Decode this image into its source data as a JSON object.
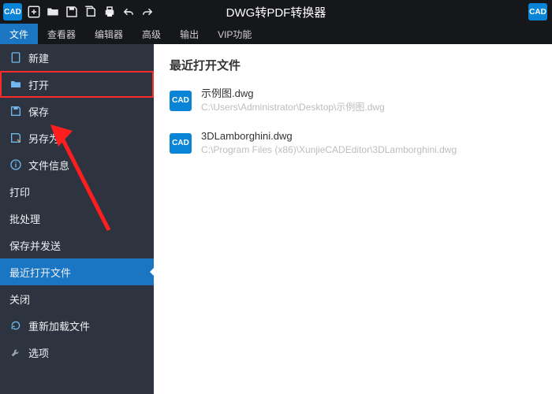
{
  "titlebar": {
    "app_badge": "CAD",
    "title": "DWG转PDF转换器"
  },
  "menubar": {
    "tabs": [
      {
        "label": "文件",
        "active": true
      },
      {
        "label": "查看器",
        "active": false
      },
      {
        "label": "编辑器",
        "active": false
      },
      {
        "label": "高级",
        "active": false
      },
      {
        "label": "输出",
        "active": false
      },
      {
        "label": "VIP功能",
        "active": false
      }
    ]
  },
  "sidebar": {
    "items": [
      {
        "icon": "file-icon",
        "label": "新建",
        "noicon": false,
        "highlighted": false,
        "selected": false
      },
      {
        "icon": "folder-icon",
        "label": "打开",
        "noicon": false,
        "highlighted": true,
        "selected": false
      },
      {
        "icon": "save-icon",
        "label": "保存",
        "noicon": false,
        "highlighted": false,
        "selected": false
      },
      {
        "icon": "saveas-icon",
        "label": "另存为",
        "noicon": false,
        "highlighted": false,
        "selected": false
      },
      {
        "icon": "info-icon",
        "label": "文件信息",
        "noicon": false,
        "highlighted": false,
        "selected": false
      },
      {
        "icon": "",
        "label": "打印",
        "noicon": true,
        "highlighted": false,
        "selected": false
      },
      {
        "icon": "",
        "label": "批处理",
        "noicon": true,
        "highlighted": false,
        "selected": false
      },
      {
        "icon": "",
        "label": "保存并发送",
        "noicon": true,
        "highlighted": false,
        "selected": false
      },
      {
        "icon": "",
        "label": "最近打开文件",
        "noicon": true,
        "highlighted": false,
        "selected": true
      },
      {
        "icon": "",
        "label": "关闭",
        "noicon": true,
        "highlighted": false,
        "selected": false
      },
      {
        "icon": "reload-icon",
        "label": "重新加载文件",
        "noicon": false,
        "highlighted": false,
        "selected": false
      },
      {
        "icon": "wrench-icon",
        "label": "选项",
        "noicon": false,
        "highlighted": false,
        "selected": false
      }
    ]
  },
  "content": {
    "heading": "最近打开文件",
    "file_badge": "CAD",
    "recent": [
      {
        "name": "示例图.dwg",
        "path": "C:\\Users\\Administrator\\Desktop\\示例图.dwg"
      },
      {
        "name": "3DLamborghini.dwg",
        "path": "C:\\Program Files (x86)\\XunjieCADEditor\\3DLamborghini.dwg"
      }
    ]
  }
}
